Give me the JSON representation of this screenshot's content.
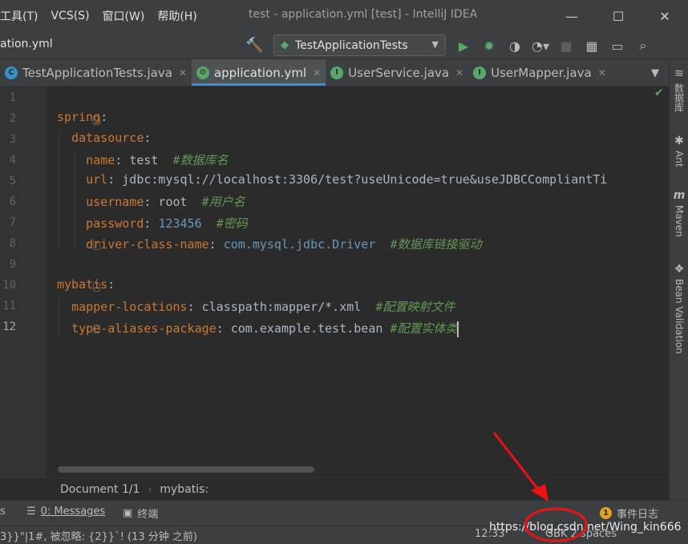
{
  "menu": [
    "工具(T)",
    "VCS(S)",
    "窗口(W)",
    "帮助(H)"
  ],
  "window_title": "test - application.yml [test] - IntelliJ IDEA",
  "window_controls": [
    "—",
    "☐",
    "✕"
  ],
  "toolbar": {
    "file_crumb": "ation.yml",
    "run_config": "TestApplicationTests"
  },
  "tabs": [
    {
      "label": "TestApplicationTests.java",
      "icon_color": "#3592c4",
      "icon": "C",
      "active": false
    },
    {
      "label": "application.yml",
      "icon_color": "#59a869",
      "icon": "⚙",
      "active": true
    },
    {
      "label": "UserService.java",
      "icon_color": "#59a869",
      "icon": "I",
      "active": false
    },
    {
      "label": "UserMapper.java",
      "icon_color": "#59a869",
      "icon": "I",
      "active": false
    }
  ],
  "right_tools": [
    "数据库",
    "Ant",
    "Maven",
    "Bean Validation"
  ],
  "line_numbers": [
    "1",
    "2",
    "3",
    "4",
    "5",
    "6",
    "7",
    "8",
    "9",
    "10",
    "11",
    "12"
  ],
  "code": {
    "l2_key": "spring",
    "l3_key": "datasource",
    "l4_key": "name",
    "l4_val": "test",
    "l4_cmt": "#数据库名",
    "l5_key": "url",
    "l5_val": "jdbc:mysql://localhost:3306/test?useUnicode=true&useJDBCCompliantTi",
    "l6_key": "username",
    "l6_val": "root",
    "l6_cmt": "#用户名",
    "l7_key": "password",
    "l7_val": "123456",
    "l7_cmt": "#密码",
    "l8_key": "driver-class-name",
    "l8_val": "com.mysql.jdbc.Driver",
    "l8_cmt": "#数据库链接驱动",
    "l10_key": "mybatis",
    "l11_key": "mapper-locations",
    "l11_val": "classpath:mapper/*.xml",
    "l11_cmt": "#配置映射文件",
    "l12_key": "type-aliases-package",
    "l12_val": "com.example.test.bean",
    "l12_cmt": "#配置实体类"
  },
  "breadcrumb": {
    "doc": "Document 1/1",
    "node": "mybatis:"
  },
  "toolwindows": {
    "messages": "0: Messages",
    "terminal": "终端",
    "event_log": "事件日志",
    "event_count": "1",
    "left_fragment": "s"
  },
  "status": {
    "message": "3}}\"|1#, 被忽略: {2}}`! (13 分钟 之前)",
    "position": "12:33",
    "encoding": "GBK  2 spaces"
  },
  "watermark": "https://blog.csdn.net/Wing_kin666"
}
